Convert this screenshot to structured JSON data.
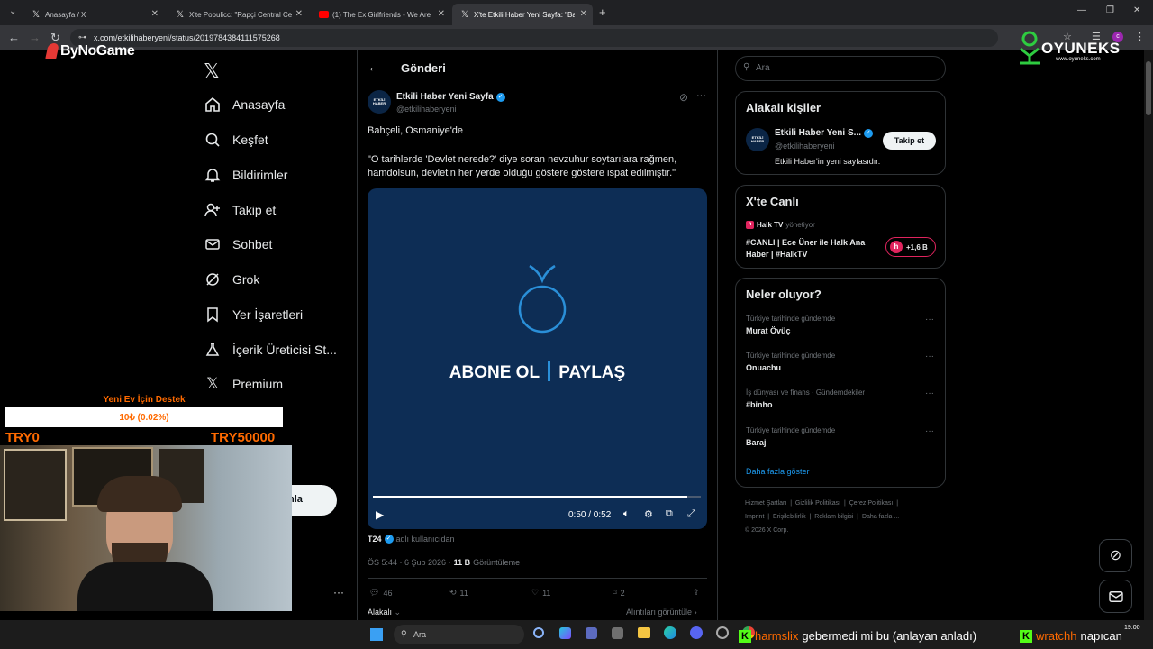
{
  "browser": {
    "tabs": [
      {
        "title": "Anasayfa / X"
      },
      {
        "title": "X'te Populicc: \"Rapçi Central Ce"
      },
      {
        "title": "(1) The Ex Girlfriends - We Are"
      },
      {
        "title": "X'te Etkili Haber Yeni Sayfa: \"Ba"
      }
    ],
    "url": "x.com/etkilihaberyeni/status/2019784384111575268"
  },
  "overlay": {
    "bynogame_logo": "ByNoGame",
    "oyuneks_logo": "OYUNEKS",
    "oyuneks_sub": "www.oyuneks.com",
    "donation_title": "Yeni Ev İçin Destek",
    "donation_progress_text": "10₺ (0.02%)",
    "donation_progress_fraction": 0.0002,
    "donation_min": "TRY0",
    "donation_max": "TRY50000"
  },
  "nav": {
    "items": [
      {
        "label": "Anasayfa",
        "icon": "home-icon"
      },
      {
        "label": "Keşfet",
        "icon": "search-icon"
      },
      {
        "label": "Bildirimler",
        "icon": "bell-icon"
      },
      {
        "label": "Takip et",
        "icon": "follow-icon"
      },
      {
        "label": "Sohbet",
        "icon": "mail-icon"
      },
      {
        "label": "Grok",
        "icon": "grok-icon"
      },
      {
        "label": "Yer İşaretleri",
        "icon": "bookmark-icon"
      },
      {
        "label": "İçerik Üreticisi St...",
        "icon": "creator-icon"
      },
      {
        "label": "Premium",
        "icon": "x-logo-icon"
      }
    ],
    "post_button_partial": "nla"
  },
  "post": {
    "header_title": "Gönderi",
    "author_name": "Etkili Haber Yeni Sayfa",
    "author_handle": "@etkilihaberyeni",
    "avatar_text": "ETKİLİ HABER",
    "text_line1": "Bahçeli, Osmaniye'de",
    "text_quote": "\"O tarihlerde 'Devlet nerede?' diye soran nevzuhur soytarılara rağmen, hamdolsun, devletin her yerde olduğu göstere göstere ispat edilmiştir.\"",
    "video_left": "ABONE OL",
    "video_right": "PAYLAŞ",
    "video_time": "0:50 / 0:52",
    "video_progress": 0.96,
    "source_name": "T24",
    "source_suffix": "adlı kullanıcıdan",
    "timestamp": "ÖS 5:44 · 6 Şub 2026 ·",
    "views_count": "11 B",
    "views_label": "Görüntüleme",
    "replies": "46",
    "reposts": "11",
    "likes": "11",
    "bookmarks": "2",
    "sort_label": "Alakalı",
    "quotes_label": "Alıntıları görüntüle"
  },
  "sidebar": {
    "search_placeholder": "Ara",
    "related_title": "Alakalı kişiler",
    "related_name": "Etkili Haber Yeni S...",
    "related_handle": "@etkilihaberyeni",
    "related_bio": "Etkili Haber'in yeni sayfasıdır.",
    "follow_label": "Takip et",
    "live_title": "X'te Canlı",
    "live_channel": "Halk TV",
    "live_status": "yönetiyor",
    "live_text": "#CANLI | Ece Üner ile Halk Ana Haber | #HalkTV",
    "live_count": "+1,6 B",
    "trends_title": "Neler oluyor?",
    "trends": [
      {
        "context": "Türkiye tarihinde gündemde",
        "name": "Murat Övüç"
      },
      {
        "context": "Türkiye tarihinde gündemde",
        "name": "Onuachu"
      },
      {
        "context": "İş dünyası ve finans · Gündemdekiler",
        "name": "#binho"
      },
      {
        "context": "Türkiye tarihinde gündemde",
        "name": "Baraj"
      }
    ],
    "show_more": "Daha fazla göster",
    "footer_line1": [
      "Hizmet Şartları",
      "|",
      "Gizlilik Politikası",
      "|",
      "Çerez Politikası",
      "|"
    ],
    "footer_line2": [
      "Imprint",
      "|",
      "Erişilebilirlik",
      "|",
      "Reklam bilgisi",
      "|",
      "Daha fazla ..."
    ],
    "footer_copyright": "© 2026 X Corp."
  },
  "taskbar": {
    "search_placeholder": "Ara",
    "chat1_user": "harmslix",
    "chat1_text": "gebermedi mi bu (anlayan anladı)",
    "chat2_user": "wratchh",
    "chat2_text": "napıcan",
    "clock": "19:00"
  },
  "colors": {
    "accent": "#1d9bf0",
    "video_bg": "#0d2d55",
    "donation_orange": "#ff6a00",
    "chat_green": "#53fc18"
  }
}
